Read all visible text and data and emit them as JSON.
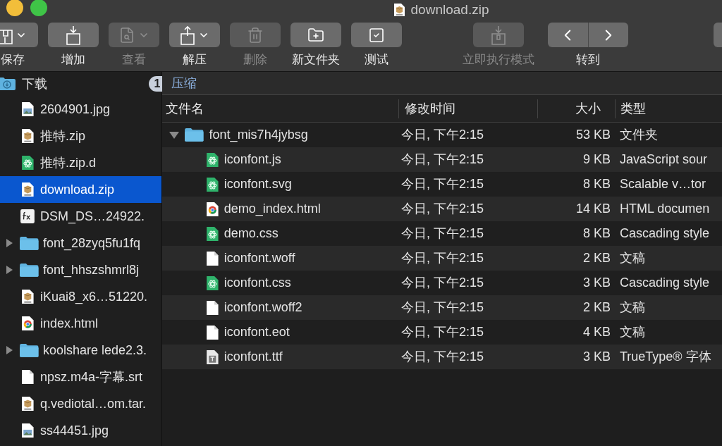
{
  "window": {
    "title": "download.zip"
  },
  "toolbar": [
    {
      "label": "保存",
      "kind": "archive",
      "disabled": false,
      "menu": true
    },
    {
      "label": "增加",
      "kind": "add",
      "disabled": false,
      "menu": false
    },
    {
      "label": "查看",
      "kind": "view",
      "disabled": true,
      "menu": true
    },
    {
      "label": "解压",
      "kind": "extract",
      "disabled": false,
      "menu": true
    },
    {
      "label": "删除",
      "kind": "trash",
      "disabled": true,
      "menu": false
    },
    {
      "label": "新文件夹",
      "kind": "new-folder",
      "disabled": false,
      "menu": false
    },
    {
      "label": "测试",
      "kind": "check",
      "disabled": false,
      "menu": false
    },
    {
      "label": "立即执行模式",
      "kind": "instant",
      "disabled": true,
      "menu": false
    },
    {
      "label": "转到",
      "kind": "nav",
      "disabled": false
    }
  ],
  "sidebar": {
    "root": {
      "label": "下载",
      "badge": "1"
    },
    "items": [
      {
        "name": "2604901.jpg",
        "kind": "image",
        "selected": false
      },
      {
        "name": "推特.zip",
        "kind": "archive",
        "selected": false
      },
      {
        "name": "推特.zip.d",
        "kind": "atom",
        "selected": false
      },
      {
        "name": "download.zip",
        "kind": "archive",
        "selected": true
      },
      {
        "name": "DSM_DS…24922.",
        "kind": "fx",
        "selected": false
      },
      {
        "name": "font_28zyq5fu1fq",
        "kind": "folder",
        "selected": false,
        "expanded": false
      },
      {
        "name": "font_hhszshmrl8j",
        "kind": "folder",
        "selected": false,
        "expanded": false
      },
      {
        "name": "iKuai8_x6…51220.",
        "kind": "archive",
        "selected": false
      },
      {
        "name": "index.html",
        "kind": "chrome",
        "selected": false
      },
      {
        "name": "koolshare lede2.3.",
        "kind": "folder",
        "selected": false,
        "expanded": false
      },
      {
        "name": "npsz.m4a-字幕.srt",
        "kind": "blank",
        "selected": false
      },
      {
        "name": "q.vediotal…om.tar.",
        "kind": "archive",
        "selected": false
      },
      {
        "name": "ss44451.jpg",
        "kind": "image",
        "selected": false
      }
    ]
  },
  "path": "压缩",
  "table": {
    "columns": [
      "文件名",
      "修改时间",
      "大小",
      "类型"
    ],
    "rows": [
      {
        "name": "font_mis7h4jybsg",
        "modified": "今日, 下午2:15",
        "size": "53 KB",
        "type": "文件夹",
        "kind": "folder",
        "expanded": true,
        "children": [
          {
            "name": "iconfont.js",
            "modified": "今日, 下午2:15",
            "size": "9 KB",
            "type": "JavaScript sour",
            "kind": "atom"
          },
          {
            "name": "iconfont.svg",
            "modified": "今日, 下午2:15",
            "size": "8 KB",
            "type": "Scalable v…tor",
            "kind": "atom"
          },
          {
            "name": "demo_index.html",
            "modified": "今日, 下午2:15",
            "size": "14 KB",
            "type": "HTML documen",
            "kind": "chrome"
          },
          {
            "name": "demo.css",
            "modified": "今日, 下午2:15",
            "size": "8 KB",
            "type": "Cascading style",
            "kind": "atom"
          },
          {
            "name": "iconfont.woff",
            "modified": "今日, 下午2:15",
            "size": "2 KB",
            "type": "文稿",
            "kind": "blank"
          },
          {
            "name": "iconfont.css",
            "modified": "今日, 下午2:15",
            "size": "3 KB",
            "type": "Cascading style",
            "kind": "atom"
          },
          {
            "name": "iconfont.woff2",
            "modified": "今日, 下午2:15",
            "size": "2 KB",
            "type": "文稿",
            "kind": "blank"
          },
          {
            "name": "iconfont.eot",
            "modified": "今日, 下午2:15",
            "size": "4 KB",
            "type": "文稿",
            "kind": "blank"
          },
          {
            "name": "iconfont.ttf",
            "modified": "今日, 下午2:15",
            "size": "3 KB",
            "type": "TrueType® 字体",
            "kind": "font"
          }
        ]
      }
    ]
  }
}
